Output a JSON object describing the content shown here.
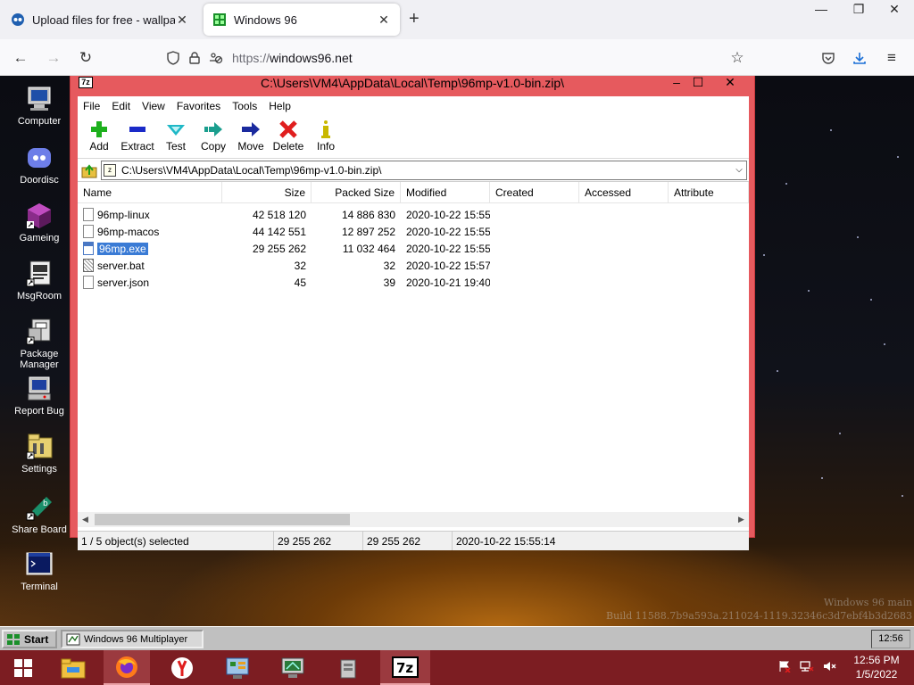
{
  "browser": {
    "tabs": [
      {
        "title": "Upload files for free - wallpaper",
        "active": false
      },
      {
        "title": "Windows 96",
        "active": true
      }
    ],
    "url_scheme": "https://",
    "url_host": "windows96.net"
  },
  "desktop": {
    "icons": [
      {
        "label": "Computer",
        "icon": "computer-icon"
      },
      {
        "label": "Doordisc",
        "icon": "discord-icon"
      },
      {
        "label": "Gameing",
        "icon": "cube-icon"
      },
      {
        "label": "MsgRoom",
        "icon": "chat-icon"
      },
      {
        "label": "Package Manager",
        "icon": "package-icon"
      },
      {
        "label": "Report Bug",
        "icon": "bug-report-icon"
      },
      {
        "label": "Settings",
        "icon": "settings-icon"
      },
      {
        "label": "Share Board",
        "icon": "share-icon"
      },
      {
        "label": "Terminal",
        "icon": "terminal-icon"
      }
    ],
    "watermark_line1": "Windows 96 main",
    "watermark_line2": "Build 11588.7b9a593a.211024-1119.32346c3d7ebf4b3d2683"
  },
  "window": {
    "app_icon_text": "7z",
    "title": "C:\\Users\\VM4\\AppData\\Local\\Temp\\96mp-v1.0-bin.zip\\",
    "menu": [
      "File",
      "Edit",
      "View",
      "Favorites",
      "Tools",
      "Help"
    ],
    "toolbar": [
      {
        "label": "Add",
        "icon": "add-plus-icon",
        "color": "#1db01d"
      },
      {
        "label": "Extract",
        "icon": "extract-minus-icon",
        "color": "#1a2ac8"
      },
      {
        "label": "Test",
        "icon": "test-check-icon",
        "color": "#1fb8c6"
      },
      {
        "label": "Copy",
        "icon": "copy-arrow-icon",
        "color": "#1a9e8e"
      },
      {
        "label": "Move",
        "icon": "move-arrow-icon",
        "color": "#1a2a9e"
      },
      {
        "label": "Delete",
        "icon": "delete-x-icon",
        "color": "#e01e1e"
      },
      {
        "label": "Info",
        "icon": "info-icon",
        "color": "#c9b800"
      }
    ],
    "address": "C:\\Users\\VM4\\AppData\\Local\\Temp\\96mp-v1.0-bin.zip\\",
    "columns": [
      "Name",
      "Size",
      "Packed Size",
      "Modified",
      "Created",
      "Accessed",
      "Attribute"
    ],
    "files": [
      {
        "name": "96mp-linux",
        "size": "42 518 120",
        "packed": "14 886 830",
        "modified": "2020-10-22 15:55",
        "type": "file",
        "selected": false
      },
      {
        "name": "96mp-macos",
        "size": "44 142 551",
        "packed": "12 897 252",
        "modified": "2020-10-22 15:55",
        "type": "file",
        "selected": false
      },
      {
        "name": "96mp.exe",
        "size": "29 255 262",
        "packed": "11 032 464",
        "modified": "2020-10-22 15:55",
        "type": "exe",
        "selected": true
      },
      {
        "name": "server.bat",
        "size": "32",
        "packed": "32",
        "modified": "2020-10-22 15:57",
        "type": "bat",
        "selected": false
      },
      {
        "name": "server.json",
        "size": "45",
        "packed": "39",
        "modified": "2020-10-21 19:40",
        "type": "file",
        "selected": false
      }
    ],
    "status": {
      "selection": "1 / 5 object(s) selected",
      "size": "29 255 262",
      "packed": "29 255 262",
      "modified": "2020-10-22 15:55:14"
    }
  },
  "w96taskbar": {
    "start_label": "Start",
    "task_label": "Windows 96 Multiplayer",
    "clock": "12:56"
  },
  "hosttaskbar": {
    "time": "12:56 PM",
    "date": "1/5/2022",
    "accent": "#7c1d22"
  }
}
